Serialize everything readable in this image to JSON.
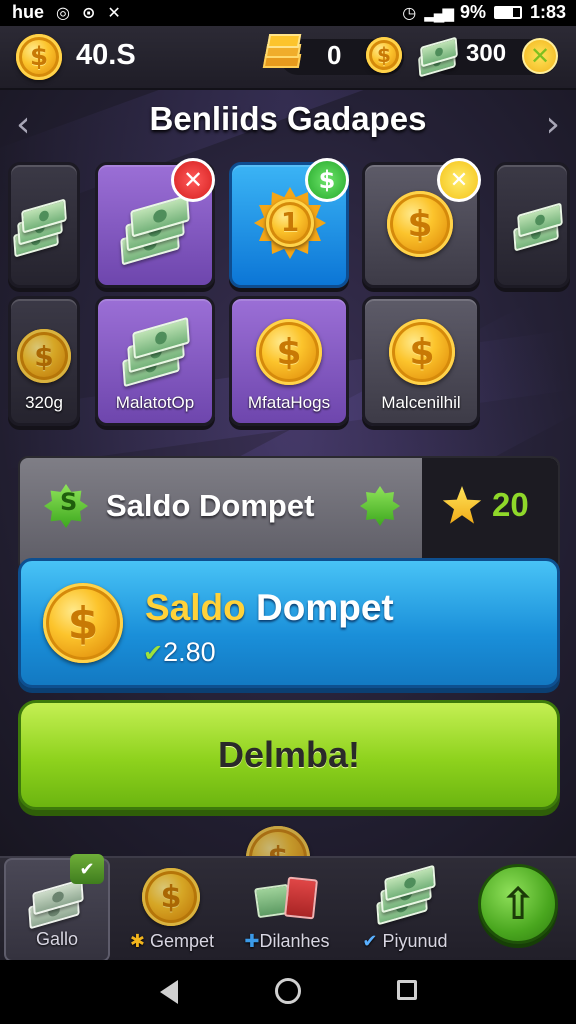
{
  "status_bar": {
    "left_text": "hue",
    "battery": "9%",
    "time": "1:83"
  },
  "top_bar": {
    "coins": "40.S",
    "stack_count": "0",
    "cash_count": "300"
  },
  "header": {
    "title": "Benliids Gadapes"
  },
  "grid": {
    "row2_labels": [
      "320g",
      "MalatotOp",
      "MfataHogs",
      "Malcenilhil"
    ]
  },
  "wallet": {
    "label": "Saldo Dompet",
    "star_count": "20",
    "main_title_1": "Saldo",
    "main_title_2": " Dompet",
    "balance": "2.80"
  },
  "cta": {
    "label": "Delmba!"
  },
  "nav": {
    "items": [
      "Gallo",
      "Gempet",
      "Dilanhes",
      "Piyunud"
    ]
  },
  "colors": {
    "accent_green": "#8ed21d",
    "accent_blue": "#1a8fd9",
    "gold": "#fcc42c",
    "gem_green": "#3da81e"
  },
  "icons": {
    "coin": "dollar-coin-icon",
    "cash": "cash-stack-icon",
    "close": "close-icon",
    "upgrade": "arrow-up-icon"
  }
}
